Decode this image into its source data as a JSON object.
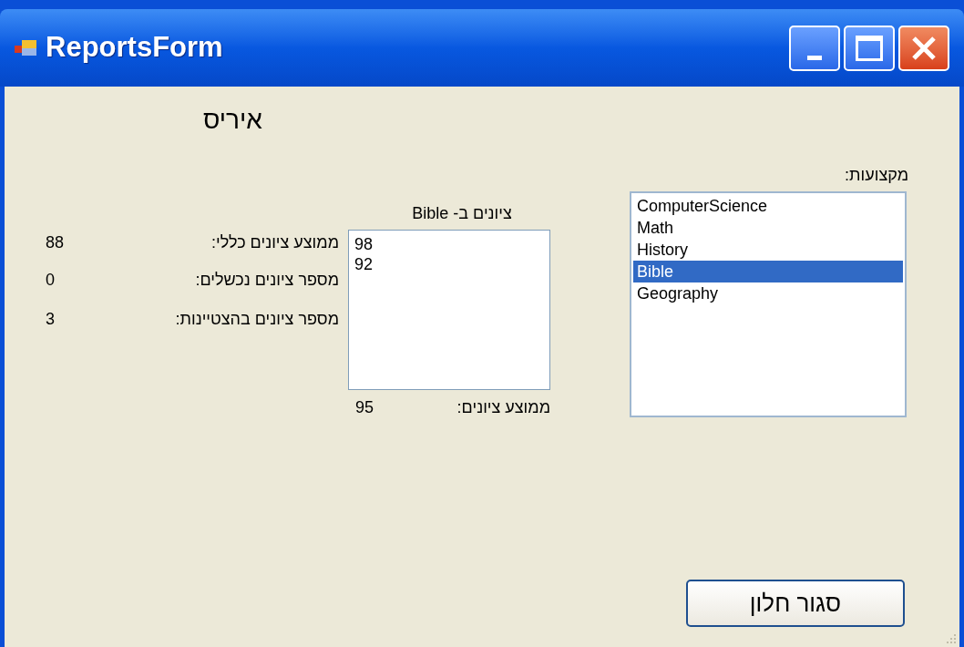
{
  "window": {
    "title": "ReportsForm"
  },
  "student_name": "איריס",
  "stats": [
    {
      "label": "ממוצע ציונים כללי:",
      "value": "88"
    },
    {
      "label": "מספר ציונים נכשלים:",
      "value": "0"
    },
    {
      "label": "מספר ציונים בהצטיינות:",
      "value": "3"
    }
  ],
  "grades": {
    "caption": "ציונים ב- Bible",
    "items": [
      "98",
      "92"
    ],
    "average_label": "ממוצע ציונים:",
    "average_value": "95"
  },
  "subjects": {
    "label": "מקצועות:",
    "items": [
      {
        "text": "ComputerScience",
        "selected": false
      },
      {
        "text": "Math",
        "selected": false
      },
      {
        "text": "History",
        "selected": false
      },
      {
        "text": "Bible",
        "selected": true
      },
      {
        "text": "Geography",
        "selected": false
      }
    ]
  },
  "buttons": [
    {
      "label": "סגור חלון"
    }
  ]
}
